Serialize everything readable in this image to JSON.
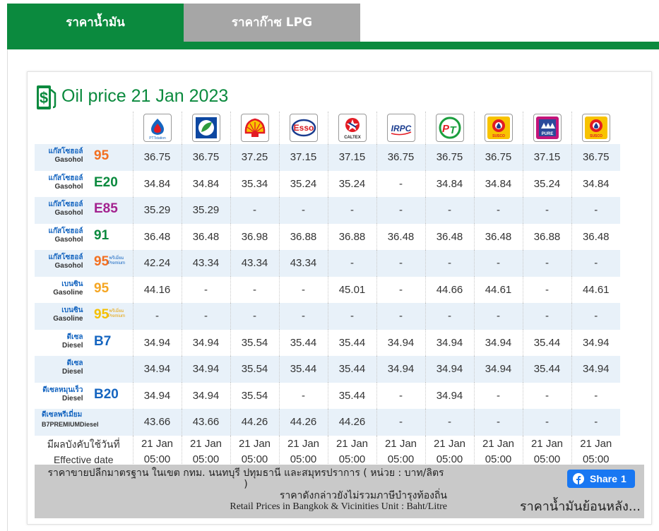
{
  "tabs": [
    {
      "label": "ราคาน้ำมัน",
      "active": true
    },
    {
      "label": "ราคาก๊าซ LPG",
      "active": false
    }
  ],
  "title": "Oil price 21 Jan 2023",
  "brands": [
    {
      "name": "PTT Station",
      "logo_icon": "ptt-station-logo",
      "color": "#1565c0"
    },
    {
      "name": "Bangchak",
      "logo_icon": "bangchak-logo",
      "color": "#0d47a1"
    },
    {
      "name": "Shell",
      "logo_icon": "shell-logo",
      "color": "#f8c300"
    },
    {
      "name": "Esso",
      "logo_icon": "esso-logo",
      "color": "#d71920"
    },
    {
      "name": "Caltex",
      "logo_icon": "caltex-logo",
      "color": "#e31b23"
    },
    {
      "name": "IRPC",
      "logo_icon": "irpc-logo",
      "color": "#1a3c8f"
    },
    {
      "name": "PT",
      "logo_icon": "pt-logo",
      "color": "#1b9e3e"
    },
    {
      "name": "Susco",
      "logo_icon": "susco-logo",
      "color": "#e31b23"
    },
    {
      "name": "Pure",
      "logo_icon": "pure-logo",
      "color": "#2b4a9b"
    },
    {
      "name": "Susco",
      "logo_icon": "susco-logo",
      "color": "#e31b23"
    }
  ],
  "logo_text": {
    "ptt": "PTTstation",
    "caltex": "CALTEX",
    "irpc": "IRPC",
    "pure": "PURE",
    "susco": "SUSCO",
    "esso": "Esso"
  },
  "fuels": [
    {
      "th": "แก๊สโซฮอล์",
      "en": "Gasohol",
      "num": "95",
      "num_color": "#f37021",
      "premium": false,
      "prices": [
        "36.75",
        "36.75",
        "37.25",
        "37.15",
        "37.15",
        "36.75",
        "36.75",
        "36.75",
        "37.15",
        "36.75"
      ]
    },
    {
      "th": "แก๊สโซฮอล์",
      "en": "Gasohol",
      "num": "E20",
      "num_color": "#0b8a3e",
      "premium": false,
      "prices": [
        "34.84",
        "34.84",
        "35.34",
        "35.24",
        "35.24",
        "-",
        "34.84",
        "34.84",
        "35.24",
        "34.84"
      ]
    },
    {
      "th": "แก๊สโซฮอล์",
      "en": "Gasohol",
      "num": "E85",
      "num_color": "#a3228f",
      "premium": false,
      "prices": [
        "35.29",
        "35.29",
        "-",
        "-",
        "-",
        "-",
        "-",
        "-",
        "-",
        "-"
      ]
    },
    {
      "th": "แก๊สโซฮอล์",
      "en": "Gasohol",
      "num": "91",
      "num_color": "#0b8a3e",
      "premium": false,
      "prices": [
        "36.48",
        "36.48",
        "36.98",
        "36.88",
        "36.88",
        "36.48",
        "36.48",
        "36.48",
        "36.88",
        "36.48"
      ]
    },
    {
      "th": "แก๊สโซฮอล์",
      "en": "Gasohol",
      "num": "95",
      "num_color": "#f37021",
      "premium": true,
      "premium_th": "พรีเมี่ยม",
      "premium_en": "Premium",
      "prices": [
        "42.24",
        "43.34",
        "43.34",
        "43.34",
        "-",
        "-",
        "-",
        "-",
        "-",
        "-"
      ]
    },
    {
      "th": "เบนซิน",
      "en": "Gasoline",
      "num": "95",
      "num_color": "#f5a623",
      "premium": false,
      "prices": [
        "44.16",
        "-",
        "-",
        "-",
        "45.01",
        "-",
        "44.66",
        "44.61",
        "-",
        "44.61"
      ]
    },
    {
      "th": "เบนซิน",
      "en": "Gasoline",
      "num": "95",
      "num_color": "#f5c000",
      "premium": true,
      "premium_th": "พรีเมี่ยม",
      "premium_en": "Premium",
      "prices": [
        "-",
        "-",
        "-",
        "-",
        "-",
        "-",
        "-",
        "-",
        "-",
        "-"
      ]
    },
    {
      "th": "ดีเซล",
      "en": "Diesel",
      "num": "B7",
      "num_color": "#1565c0",
      "premium": false,
      "prices": [
        "34.94",
        "34.94",
        "35.54",
        "35.44",
        "35.44",
        "34.94",
        "34.94",
        "34.94",
        "35.44",
        "34.94"
      ]
    },
    {
      "th": "ดีเซล",
      "en": "Diesel",
      "num": "",
      "num_color": "#1565c0",
      "premium": false,
      "prices": [
        "34.94",
        "34.94",
        "35.54",
        "35.44",
        "35.44",
        "34.94",
        "34.94",
        "34.94",
        "35.44",
        "34.94"
      ]
    },
    {
      "th": "ดีเซลหมุนเร็ว",
      "en": "Diesel",
      "num": "B20",
      "num_color": "#1565c0",
      "premium": false,
      "prices": [
        "34.94",
        "34.94",
        "35.54",
        "-",
        "35.44",
        "-",
        "34.94",
        "-",
        "-",
        "-"
      ]
    },
    {
      "th": "ดีเซลพรีเมี่ยม",
      "en": "B7PREMIUMDiesel",
      "num": "",
      "num_color": "#1565c0",
      "premium": false,
      "style": "left",
      "prices": [
        "43.66",
        "43.66",
        "44.26",
        "44.26",
        "44.26",
        "-",
        "-",
        "-",
        "-",
        "-"
      ]
    }
  ],
  "effective": {
    "label_th": "มีผลบังคับใช้วันที่",
    "label_en": "Effective date",
    "dates": [
      "21 Jan",
      "21 Jan",
      "21 Jan",
      "21 Jan",
      "21 Jan",
      "21 Jan",
      "21 Jan",
      "21 Jan",
      "21 Jan",
      "21 Jan"
    ],
    "times": [
      "05:00",
      "05:00",
      "05:00",
      "05:00",
      "05:00",
      "05:00",
      "05:00",
      "05:00",
      "05:00",
      "05:00"
    ]
  },
  "footer": {
    "note_th_1": "ราคาขายปลีกมาตรฐาน ในเขต กทม. นนทบุรี ปทุมธานี และสมุทรปราการ ( หน่วย : บาท/ลิตร )",
    "note_th_2": "ราคาดังกล่าวยังไม่รวมภาษีบำรุงท้องถิ่น",
    "note_en": "Retail Prices in Bangkok & Vicinities Unit : Baht/Litre",
    "share_label": "Share",
    "share_count": "1",
    "history_link": "ราคาน้ำมันย้อนหลัง..."
  },
  "colors": {
    "green": "#0b8a3e",
    "tab_inactive": "#a6a6a6",
    "zebra": "#e8f1f9",
    "footer_bg": "#c9c9c9",
    "facebook": "#1877f2"
  }
}
